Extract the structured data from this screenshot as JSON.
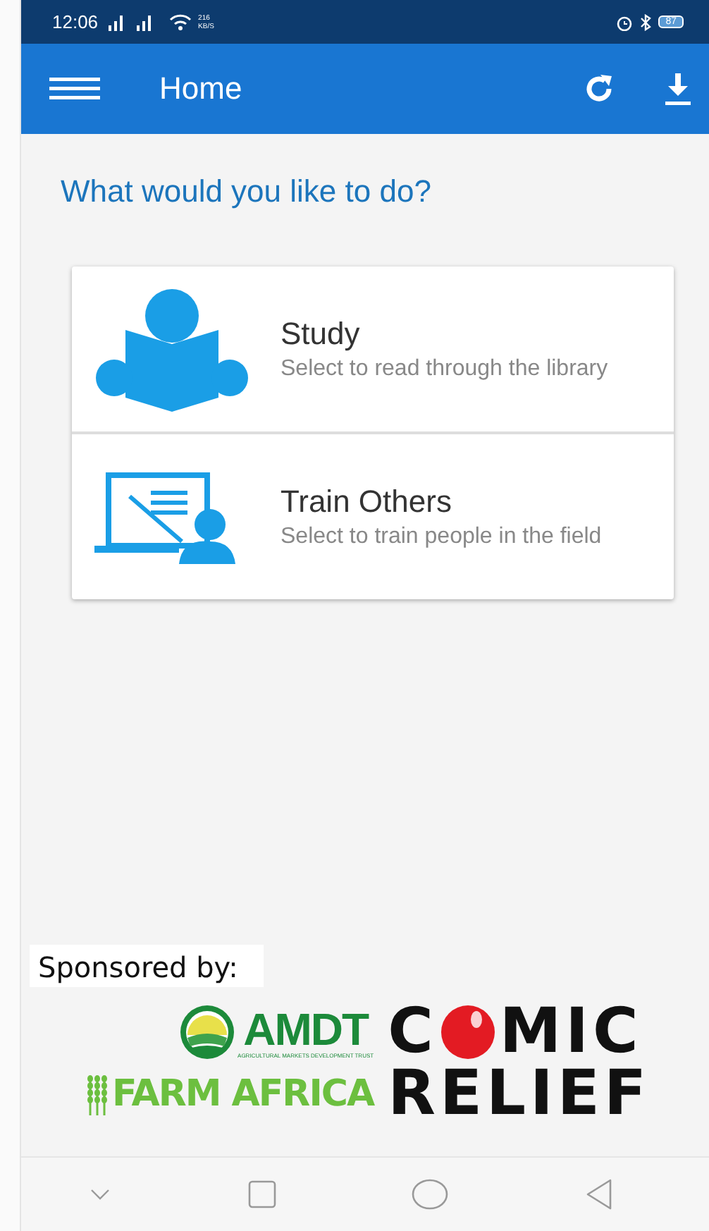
{
  "status_bar": {
    "time": "12:06",
    "net_speed": [
      "216",
      "KB/S"
    ],
    "battery": "87"
  },
  "app_bar": {
    "title": "Home"
  },
  "prompt": "What would you like to do?",
  "options": [
    {
      "kind": "study",
      "title": "Study",
      "subtitle": "Select to read through the library"
    },
    {
      "kind": "train",
      "title": "Train Others",
      "subtitle": "Select to train people in the field"
    }
  ],
  "sponsors": {
    "label": "Sponsored by:",
    "logos": [
      {
        "kind": "amdt",
        "name": "AMDT",
        "tagline": "AGRICULTURAL MARKETS DEVELOPMENT TRUST"
      },
      {
        "kind": "comic",
        "line1_start": "C",
        "line1_end": "MIC"
      },
      {
        "kind": "farm",
        "name": "FARM AFRICA"
      },
      {
        "kind": "comic2",
        "line2": "RELIEF"
      }
    ]
  }
}
